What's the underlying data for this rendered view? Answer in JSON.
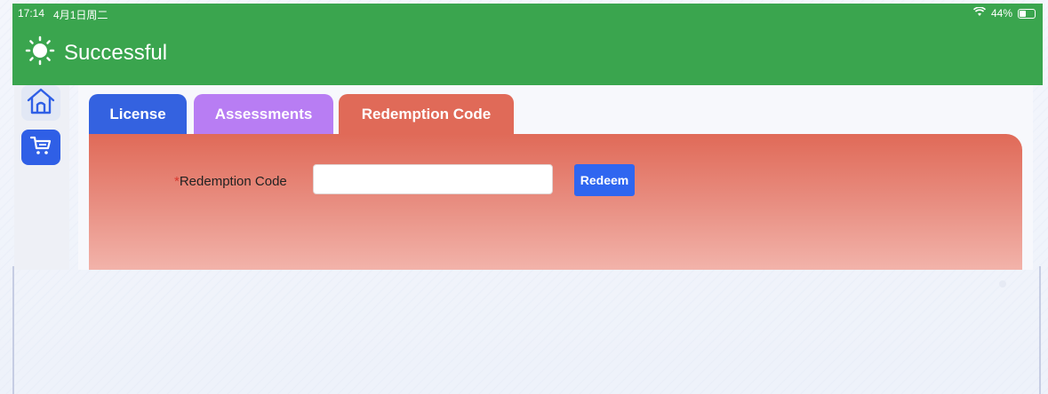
{
  "status_bar": {
    "time": "17:14",
    "date": "4月1日周二",
    "battery_percent": "44%",
    "battery_level": 0.44
  },
  "header": {
    "title": "Successful",
    "logo_icon": "sun-icon",
    "color": "#3aa54e"
  },
  "sidebar": {
    "items": [
      {
        "name": "home",
        "icon": "home-icon"
      },
      {
        "name": "cart",
        "icon": "cart-icon"
      }
    ]
  },
  "tabs": [
    {
      "label": "License",
      "color": "#3462e0"
    },
    {
      "label": "Assessments",
      "color": "#b87df3"
    },
    {
      "label": "Redemption Code",
      "color": "#e06a58",
      "active": true
    }
  ],
  "form": {
    "required_mark": "*",
    "label": "Redemption Code",
    "input_value": "",
    "input_placeholder": "",
    "button_label": "Redeem",
    "button_color": "#2f66f0"
  }
}
